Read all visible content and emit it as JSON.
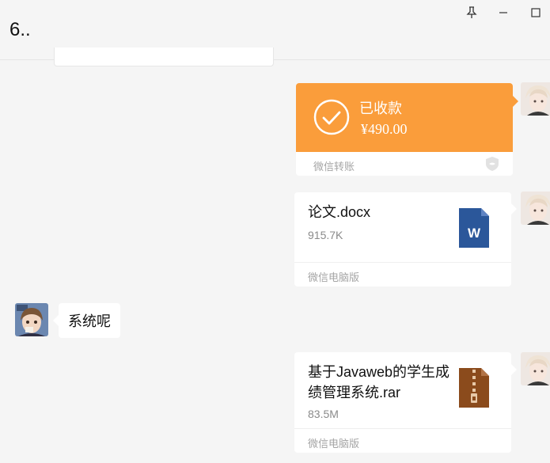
{
  "window": {
    "title": "6..",
    "pin_icon": "pin-icon",
    "minimize_icon": "minimize-icon",
    "maximize_icon": "maximize-icon"
  },
  "messages": {
    "transfer": {
      "status": "已收款",
      "amount": "¥490.00",
      "source": "微信转账",
      "accent_color": "#fa9d3b"
    },
    "file1": {
      "name": "论文.docx",
      "size": "915.7K",
      "source": "微信电脑版",
      "icon": "word-document-icon",
      "icon_color": "#2b579a"
    },
    "text1": {
      "text": "系统呢"
    },
    "file2": {
      "name": "基于Javaweb的学生成绩管理系统.rar",
      "size": "83.5M",
      "source": "微信电脑版",
      "icon": "archive-file-icon",
      "icon_color": "#8b4b1c"
    }
  }
}
